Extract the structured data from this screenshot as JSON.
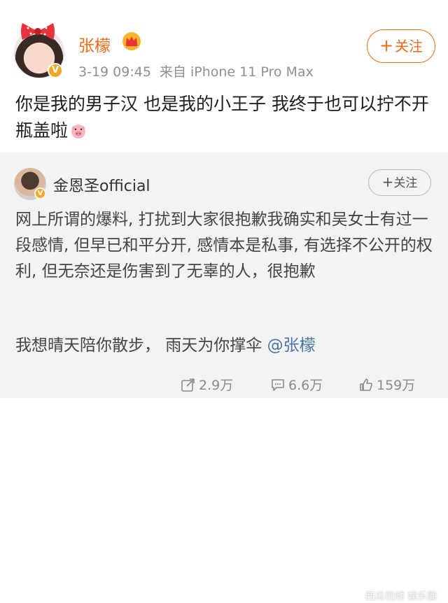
{
  "post": {
    "author": "张檬",
    "time": "3-19 09:45",
    "source": "来自 iPhone 11 Pro Max",
    "follow_label": "关注",
    "follow_plus": "+",
    "text": "你是我的男子汉  也是我的小王子  我终于也可以拧不开瓶盖啦",
    "verified_badge": "V",
    "colors": {
      "name": "#f26b15",
      "accent": "#f26b15",
      "verified": "#f5a623"
    }
  },
  "repost": {
    "author": "金恩圣official",
    "follow_label": "关注",
    "follow_plus": "+",
    "verified_badge": "V",
    "text": "网上所谓的爆料, 打扰到大家很抱歉我确实和吴女士有过一段感情, 但早已和平分开, 感情本是私事, 有选择不公开的权利, 但无奈还是伤害到了无辜的人，很抱歉",
    "text2_prefix": "我想晴天陪你散步，  雨天为你撑伞 ",
    "mention": "@张檬",
    "actions": {
      "repost_count": "2.9万",
      "comment_count": "6.6万",
      "like_count": "159万"
    },
    "watermark": "西瓜视频 娱乐圈"
  },
  "icons": {
    "repost": "repost-icon",
    "comment": "comment-icon",
    "like": "like-icon",
    "crown": "crown-icon",
    "pig": "pig-emoji-icon",
    "bow": "bow-icon"
  }
}
